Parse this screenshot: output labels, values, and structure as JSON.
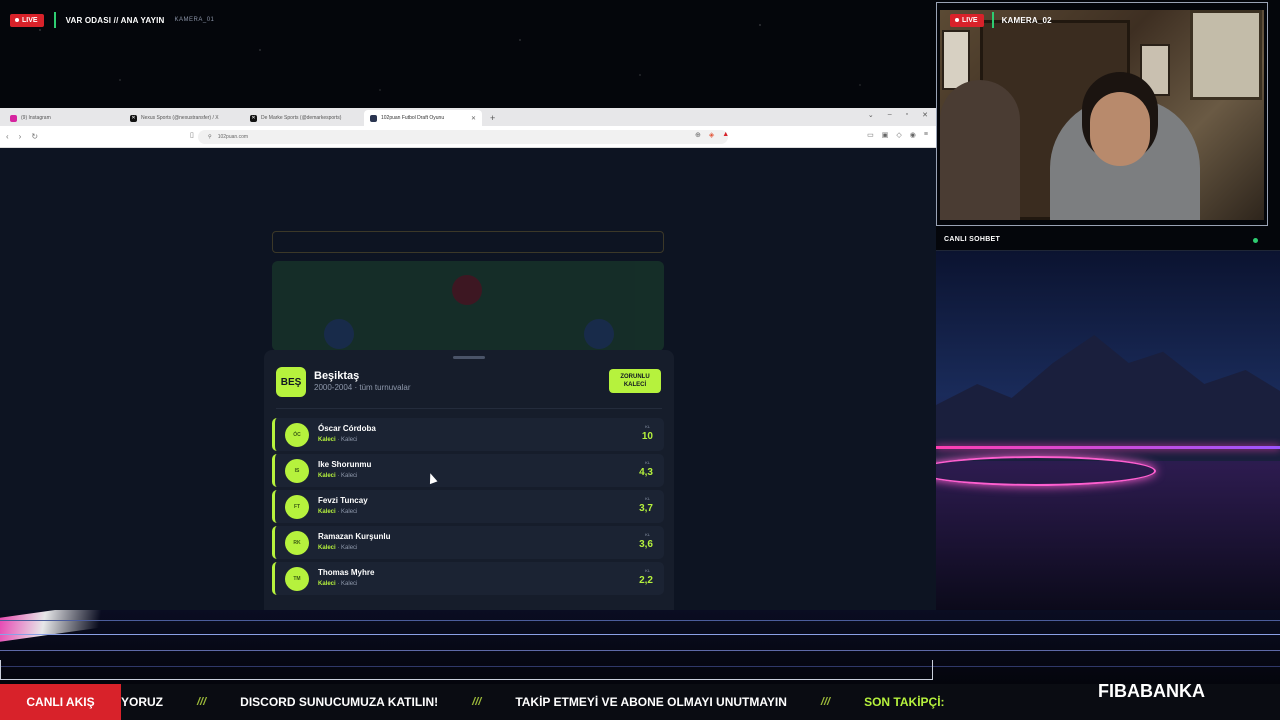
{
  "stream": {
    "live_label": "LIVE",
    "title": "VAR ODASI // ANA YAYIN",
    "camera_1": "KAMERA_01",
    "camera_2": "KAMERA_02",
    "chat_title": "CANLI SOHBET"
  },
  "browser": {
    "tabs": [
      {
        "label": "(9) Instagram",
        "icon_color": "#d6249f"
      },
      {
        "label": "Nexus Sports (@nexustransfer) / X",
        "icon_color": "#111111"
      },
      {
        "label": "De Marke Sports (@demarkesports)",
        "icon_color": "#111111"
      },
      {
        "label": "102puan Futbol Draft Oyunu",
        "icon_color": "#2a3550"
      }
    ],
    "url": "102puan.com"
  },
  "modal": {
    "team_badge": "BEŞ",
    "team_name": "Beşiktaş",
    "team_sub": "2000-2004 · tüm turnuvalar",
    "forced_line1": "ZORUNLU",
    "forced_line2": "KALECİ",
    "players": [
      {
        "initials": "ÓC",
        "name": "Óscar Córdoba",
        "role": "Kaleci",
        "position": "Kaleci",
        "kl_label": "KL",
        "value": "10"
      },
      {
        "initials": "IS",
        "name": "Ike Shorunmu",
        "role": "Kaleci",
        "position": "Kaleci",
        "kl_label": "KL",
        "value": "4,3"
      },
      {
        "initials": "FT",
        "name": "Fevzi Tuncay",
        "role": "Kaleci",
        "position": "Kaleci",
        "kl_label": "KL",
        "value": "3,7"
      },
      {
        "initials": "RK",
        "name": "Ramazan Kurşunlu",
        "role": "Kaleci",
        "position": "Kaleci",
        "kl_label": "KL",
        "value": "3,6"
      },
      {
        "initials": "TM",
        "name": "Thomas Myhre",
        "role": "Kaleci",
        "position": "Kaleci",
        "kl_label": "KL",
        "value": "2,2"
      }
    ]
  },
  "ticker": {
    "label": "CANLI AKIŞ",
    "items": [
      "YORUZ",
      "DISCORD SUNUCUMUZA KATILIN!",
      "TAKİP ETMEYİ VE ABONE OLMAYI UNUTMAYIN",
      "SON TAKİPÇİ:"
    ],
    "separator": "///",
    "last_follower": "FIBABANKA"
  },
  "colors": {
    "accent": "#b6f23d",
    "live_red": "#d8222a",
    "online_green": "#2ecc71"
  }
}
